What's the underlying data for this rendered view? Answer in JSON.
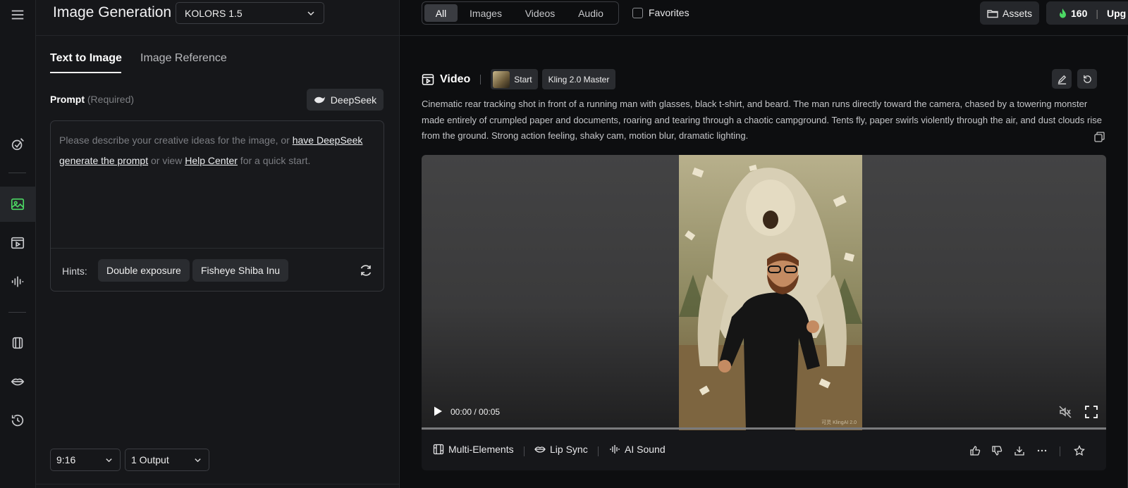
{
  "header": {
    "title": "Image Generation",
    "model": "KOLORS 1.5"
  },
  "left_tabs": [
    "Text to Image",
    "Image Reference"
  ],
  "prompt": {
    "label": "Prompt",
    "required": "(Required)",
    "deepseek_label": "DeepSeek",
    "placeholder_part1": "Please describe your creative ideas for the image, or ",
    "link1": "have DeepSeek generate the prompt",
    "placeholder_part2": " or view ",
    "link2": "Help Center",
    "placeholder_part3": " for a quick start."
  },
  "hints": {
    "label": "Hints:",
    "items": [
      "Double exposure",
      "Fisheye Shiba Inu"
    ]
  },
  "settings": {
    "ratio": "9:16",
    "outputs": "1 Output"
  },
  "filters": {
    "items": [
      "All",
      "Images",
      "Videos",
      "Audio"
    ],
    "active": "All",
    "favorites_label": "Favorites"
  },
  "top_right": {
    "assets_label": "Assets",
    "credits": "160",
    "upgrade_label": "Upg"
  },
  "video": {
    "title": "Video",
    "start_label": "Start",
    "model": "Kling 2.0 Master",
    "description": "Cinematic rear tracking shot in front of a running man with glasses, black t-shirt, and beard. The man runs directly toward the camera, chased by a towering monster made entirely of crumpled paper and documents, roaring and tearing through a chaotic campground. Tents fly, paper swirls violently through the air, and dust clouds rise from the ground. Strong action feeling, shaky cam, motion blur, dramatic lighting.",
    "time": "00:00 / 00:05",
    "watermark": "可灵 KlingAI 2.0",
    "progress": 0
  },
  "actions": {
    "multi_elements": "Multi-Elements",
    "lip_sync": "Lip Sync",
    "ai_sound": "AI Sound"
  },
  "colors": {
    "background": "#0d0e10",
    "panel": "#16171a",
    "accent_green": "#4cd964",
    "chip": "#2a2c30"
  }
}
